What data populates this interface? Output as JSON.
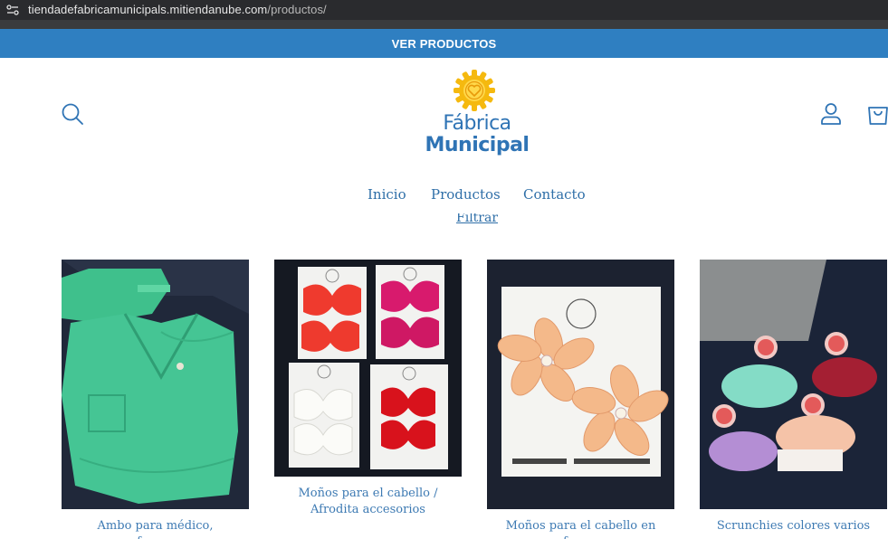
{
  "browser": {
    "url_host": "tiendadefabricamunicipals.mitiendanube.com",
    "url_path": "/productos/"
  },
  "announcement": {
    "text": "VER PRODUCTOS"
  },
  "header": {
    "logo_line1": "Fábrica",
    "logo_line2": "Municipal",
    "icons": [
      "search-icon",
      "user-icon",
      "shopping-bag-icon"
    ]
  },
  "nav": {
    "items": [
      {
        "label": "Inicio"
      },
      {
        "label": "Productos"
      },
      {
        "label": "Contacto"
      }
    ]
  },
  "filter": {
    "label": "Filtrar"
  },
  "products": [
    {
      "name": "Ambo para médico, enfermero,"
    },
    {
      "name": "Moños para el cabello / Afrodita accesorios"
    },
    {
      "name": "Moños para el cabello en forma"
    },
    {
      "name": "Scrunchies colores varios"
    }
  ],
  "colors": {
    "announcement_bg": "#2f7fc1",
    "brand_blue": "#2f74b5",
    "logo_sun": "#f5c518",
    "link": "#2f6fa8"
  }
}
